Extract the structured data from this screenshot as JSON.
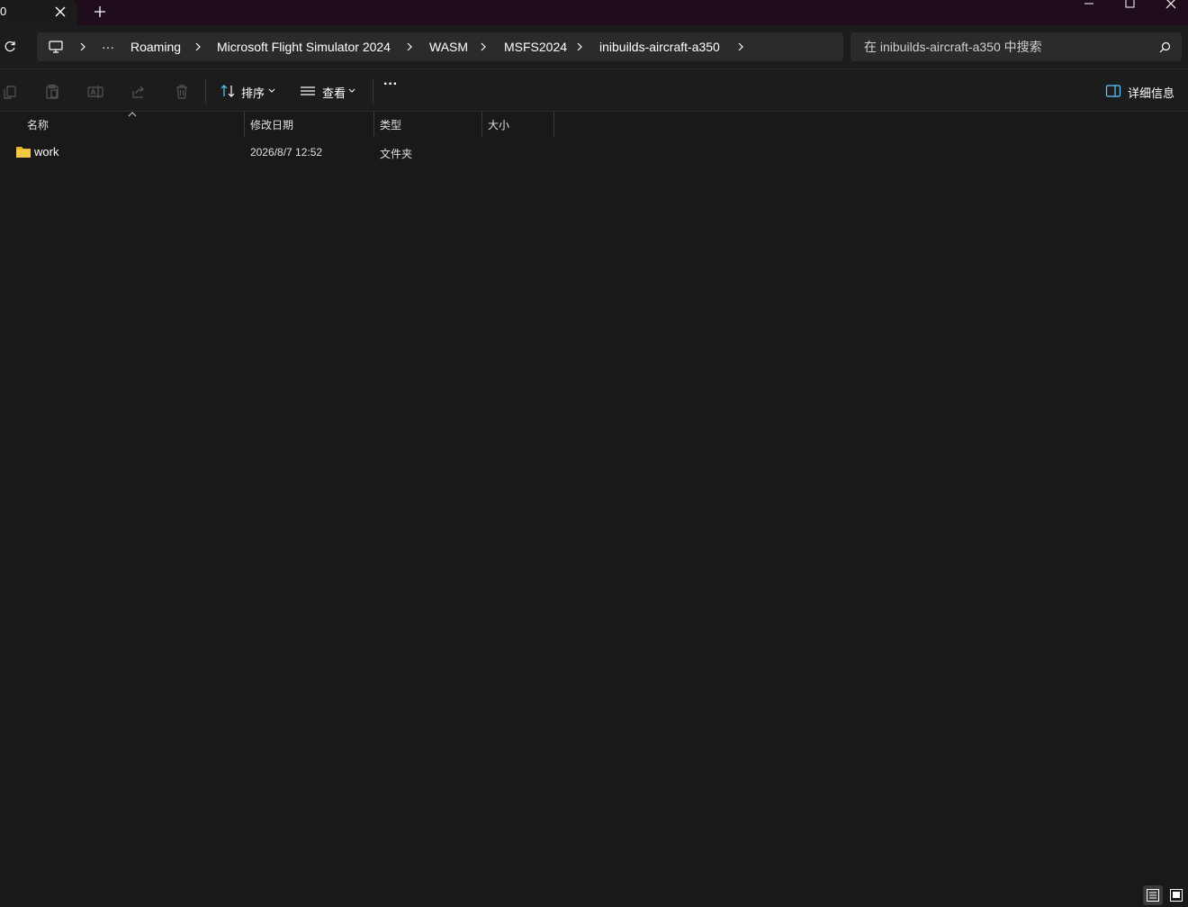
{
  "window": {
    "tab_title": "0",
    "buttons": [
      "minimize-icon",
      "maximize-icon",
      "close-icon"
    ]
  },
  "addressbar": {
    "breadcrumb": [
      "Roaming",
      "Microsoft Flight Simulator 2024",
      "WASM",
      "MSFS2024",
      "inibuilds-aircraft-a350"
    ],
    "overflow": "···",
    "search_placeholder": "在 inibuilds-aircraft-a350 中搜索"
  },
  "toolbar": {
    "sort_label": "排序",
    "view_label": "查看",
    "more_label": "···",
    "details_label": "详细信息",
    "icons": [
      "copy-icon",
      "paste-icon",
      "rename-icon",
      "share-icon",
      "delete-icon"
    ]
  },
  "columns": [
    "名称",
    "修改日期",
    "类型",
    "大小"
  ],
  "files": [
    {
      "name": "work",
      "modified": "2026/8/7 12:52",
      "type": "文件夹",
      "size": "",
      "icon": "folder-icon"
    }
  ],
  "colors": {
    "background": "#191919",
    "titlebar": "#1f0d1c",
    "accent": "#60cdff",
    "folder": "#f5c944"
  }
}
